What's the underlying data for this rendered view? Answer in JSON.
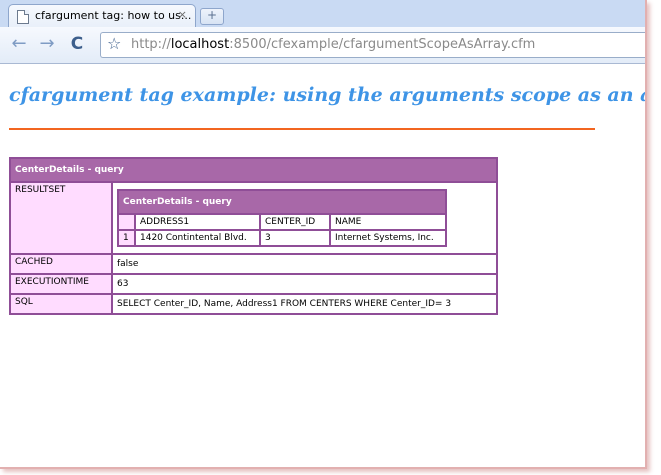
{
  "browser": {
    "tab_title": "cfargument tag: how to us...",
    "tab_close": "×",
    "new_tab": "+",
    "back": "←",
    "forward": "→",
    "reload": "C",
    "star": "☆",
    "url_scheme": "http://",
    "url_host": "localhost",
    "url_rest": ":8500/cfexample/cfargumentScopeAsArray.cfm"
  },
  "page": {
    "title": "cfargument tag example: using the arguments scope as an array"
  },
  "dump": {
    "header": "CenterDetails - query",
    "rows": {
      "resultset_label": "RESULTSET",
      "cached_label": "CACHED",
      "cached_value": "false",
      "executiontime_label": "EXECUTIONTIME",
      "executiontime_value": "63",
      "sql_label": "SQL",
      "sql_value": "SELECT Center_ID, Name, Address1 FROM CENTERS WHERE Center_ID= 3"
    },
    "resultset": {
      "header": "CenterDetails - query",
      "columns": [
        "ADDRESS1",
        "CENTER_ID",
        "NAME"
      ],
      "row": {
        "index": "1",
        "cells": [
          "1420 Contintental Blvd.",
          "3",
          "Internet Systems, Inc."
        ]
      }
    }
  },
  "colors": {
    "title": "#3e94e6",
    "rule": "#f26520",
    "dump_border": "#8f4e97",
    "dump_header": "#a868a8",
    "dump_key": "#ffdcff"
  }
}
